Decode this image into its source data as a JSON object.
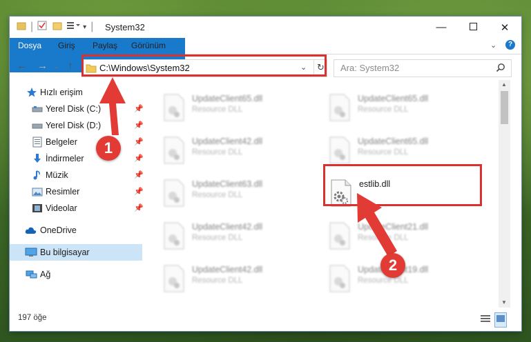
{
  "window": {
    "title": "System32"
  },
  "ribbon": {
    "tabs": [
      "Dosya",
      "Giriş",
      "Paylaş",
      "Görünüm"
    ]
  },
  "address": {
    "path": "C:\\Windows\\System32",
    "search_placeholder": "Ara: System32"
  },
  "nav": {
    "items": [
      {
        "label": "Hızlı erişim",
        "icon": "star-icon"
      },
      {
        "label": "Yerel Disk (C:)",
        "icon": "drive-icon"
      },
      {
        "label": "Yerel Disk (D:)",
        "icon": "drive-icon"
      },
      {
        "label": "Belgeler",
        "icon": "document-icon"
      },
      {
        "label": "İndirmeler",
        "icon": "download-icon"
      },
      {
        "label": "Müzik",
        "icon": "music-icon"
      },
      {
        "label": "Resimler",
        "icon": "pictures-icon"
      },
      {
        "label": "Videolar",
        "icon": "video-icon"
      },
      {
        "label": "OneDrive",
        "icon": "cloud-icon"
      },
      {
        "label": "Bu bilgisayar",
        "icon": "computer-icon"
      },
      {
        "label": "Ağ",
        "icon": "network-icon"
      }
    ]
  },
  "files": {
    "items": [
      {
        "name": "UpdateClient65.dll",
        "desc": "Resource DLL"
      },
      {
        "name": "UpdateClient65.dll",
        "desc": "Resource DLL"
      },
      {
        "name": "UpdateClient42.dll",
        "desc": "Resource DLL"
      },
      {
        "name": "UpdateClient65.dll",
        "desc": "Resource DLL"
      },
      {
        "name": "UpdateClient63.dll",
        "desc": "Resource DLL"
      },
      {
        "name": "estlib.dll",
        "desc": ""
      },
      {
        "name": "UpdateClient42.dll",
        "desc": "Resource DLL"
      },
      {
        "name": "UpdateClient21.dll",
        "desc": "Resource DLL"
      },
      {
        "name": "UpdateClient42.dll",
        "desc": "Resource DLL"
      },
      {
        "name": "UpdateClient19.dll",
        "desc": "Resource DLL"
      }
    ]
  },
  "status": {
    "count": "197 öğe"
  },
  "annotations": {
    "step1": "1",
    "step2": "2"
  },
  "colors": {
    "accent": "#1979ca",
    "highlight": "#d8312e",
    "selected": "#cce4f7"
  }
}
